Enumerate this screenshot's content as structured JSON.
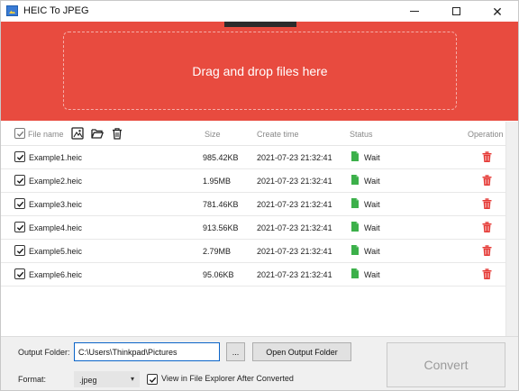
{
  "window": {
    "title": "HEIC To JPEG"
  },
  "drop_zone": {
    "text": "Drag and drop files here",
    "color": "#e84b3f"
  },
  "table": {
    "headers": {
      "file_name": "File name",
      "size": "Size",
      "create_time": "Create time",
      "status": "Status",
      "operation": "Operation"
    },
    "toolbar_icons": [
      "add-image-icon",
      "open-folder-icon",
      "trash-icon"
    ],
    "rows": [
      {
        "checked": true,
        "name": "Example1.heic",
        "size": "985.42KB",
        "time": "2021-07-23 21:32:41",
        "status": "Wait"
      },
      {
        "checked": true,
        "name": "Example2.heic",
        "size": "1.95MB",
        "time": "2021-07-23 21:32:41",
        "status": "Wait"
      },
      {
        "checked": true,
        "name": "Example3.heic",
        "size": "781.46KB",
        "time": "2021-07-23 21:32:41",
        "status": "Wait"
      },
      {
        "checked": true,
        "name": "Example4.heic",
        "size": "913.56KB",
        "time": "2021-07-23 21:32:41",
        "status": "Wait"
      },
      {
        "checked": true,
        "name": "Example5.heic",
        "size": "2.79MB",
        "time": "2021-07-23 21:32:41",
        "status": "Wait"
      },
      {
        "checked": true,
        "name": "Example6.heic",
        "size": "95.06KB",
        "time": "2021-07-23 21:32:41",
        "status": "Wait"
      }
    ],
    "status_icon_color": "#3cb04a",
    "delete_icon_color": "#e53935"
  },
  "bottom": {
    "output_folder_label": "Output Folder:",
    "output_folder_value": "C:\\Users\\Thinkpad\\Pictures",
    "browse_label": "...",
    "open_output_label": "Open Output Folder",
    "format_label": "Format:",
    "format_value": ".jpeg",
    "view_in_explorer_label": "View in File Explorer After Converted",
    "view_in_explorer_checked": true,
    "convert_label": "Convert"
  }
}
